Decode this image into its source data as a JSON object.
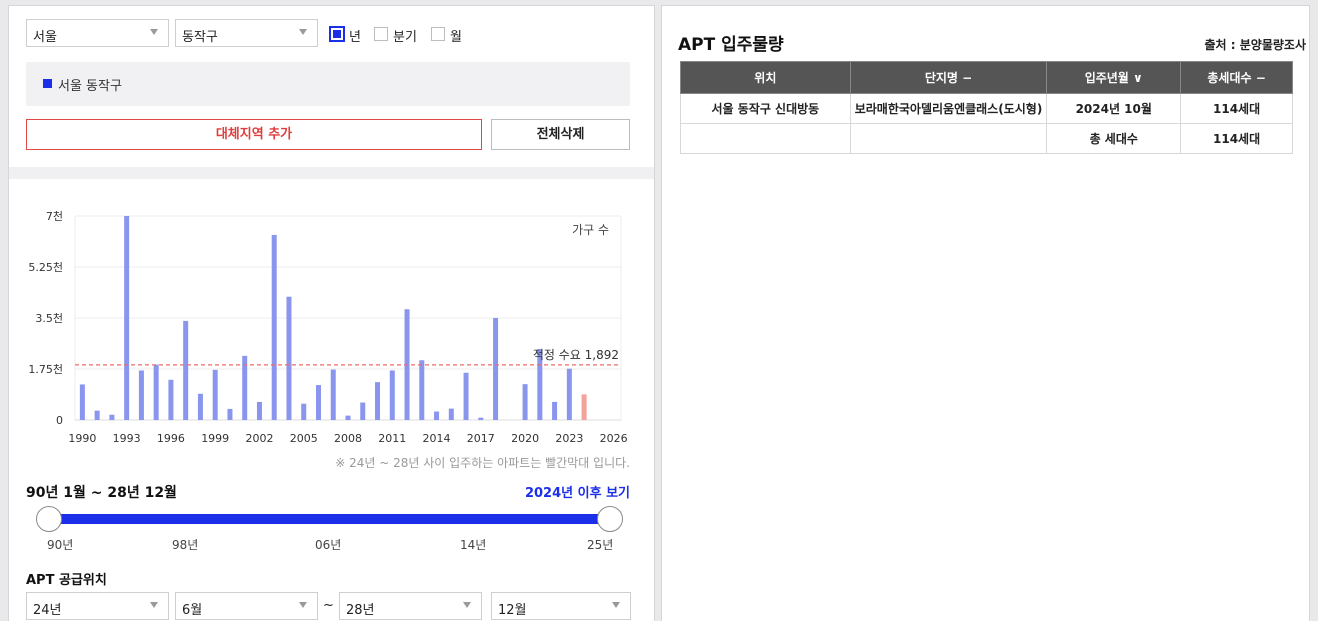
{
  "filters": {
    "city": "서울",
    "district": "동작구",
    "periods": [
      {
        "label": "년",
        "checked": true
      },
      {
        "label": "분기",
        "checked": false
      },
      {
        "label": "월",
        "checked": false
      }
    ]
  },
  "selected_region": "서울 동작구",
  "buttons": {
    "add_region": "대체지역 추가",
    "clear_all": "전체삭제"
  },
  "chart_data": {
    "type": "bar",
    "series_label": "가구 수",
    "y_ticks": [
      "7천",
      "5.25천",
      "3.5천",
      "1.75천",
      "0"
    ],
    "ylim": [
      0,
      7000
    ],
    "x_ticks": [
      "1990",
      "1993",
      "1996",
      "1999",
      "2002",
      "2005",
      "2008",
      "2011",
      "2014",
      "2017",
      "2020",
      "2023",
      "2026"
    ],
    "xlim": [
      1989.5,
      2026.5
    ],
    "reference_line": {
      "label": "적정 수요 1,892",
      "value": 1892
    },
    "bars": [
      {
        "year": 1990,
        "value": 1220
      },
      {
        "year": 1991,
        "value": 320
      },
      {
        "year": 1992,
        "value": 180
      },
      {
        "year": 1993,
        "value": 7000
      },
      {
        "year": 1994,
        "value": 1700
      },
      {
        "year": 1995,
        "value": 1900
      },
      {
        "year": 1996,
        "value": 1380
      },
      {
        "year": 1997,
        "value": 3400
      },
      {
        "year": 1998,
        "value": 900
      },
      {
        "year": 1999,
        "value": 1720
      },
      {
        "year": 2000,
        "value": 380
      },
      {
        "year": 2001,
        "value": 2200
      },
      {
        "year": 2002,
        "value": 620
      },
      {
        "year": 2003,
        "value": 6350
      },
      {
        "year": 2004,
        "value": 4230
      },
      {
        "year": 2005,
        "value": 560
      },
      {
        "year": 2006,
        "value": 1200
      },
      {
        "year": 2007,
        "value": 1730
      },
      {
        "year": 2008,
        "value": 150
      },
      {
        "year": 2009,
        "value": 600
      },
      {
        "year": 2010,
        "value": 1300
      },
      {
        "year": 2011,
        "value": 1700
      },
      {
        "year": 2012,
        "value": 3800
      },
      {
        "year": 2013,
        "value": 2050
      },
      {
        "year": 2014,
        "value": 290
      },
      {
        "year": 2015,
        "value": 390
      },
      {
        "year": 2016,
        "value": 1620
      },
      {
        "year": 2017,
        "value": 80
      },
      {
        "year": 2018,
        "value": 3500
      },
      {
        "year": 2020,
        "value": 1230
      },
      {
        "year": 2021,
        "value": 2430
      },
      {
        "year": 2022,
        "value": 620
      },
      {
        "year": 2023,
        "value": 1760
      },
      {
        "year": 2024,
        "value": 880,
        "future": true
      }
    ],
    "colors": {
      "bar": "#8a95ee",
      "future_bar": "#f2a39c",
      "reference": "#ee6b6b"
    }
  },
  "chart_note": "※ 24년 ~ 28년 사이 입주하는 아파트는 빨간막대 입니다.",
  "range": {
    "label": "90년 1월 ~ 28년 12월",
    "after_link": "2024년 이후 보기",
    "ticks": [
      "90년",
      "98년",
      "06년",
      "14년",
      "25년"
    ]
  },
  "supply": {
    "title": "APT 공급위치",
    "from_year": "24년",
    "from_month": "6월",
    "separator": "~",
    "to_year": "28년",
    "to_month": "12월"
  },
  "apt_panel": {
    "title": "APT 입주물량",
    "source": "출처 : 분양물량조사",
    "headers": [
      "위치",
      "단지명 −",
      "입주년월 ∨",
      "총세대수 −"
    ],
    "rows": [
      [
        "서울 동작구 신대방동",
        "보라매한국아델리움엔클래스(도시형)",
        "2024년 10월",
        "114세대"
      ],
      [
        "",
        "",
        "총 세대수",
        "114세대"
      ]
    ]
  }
}
